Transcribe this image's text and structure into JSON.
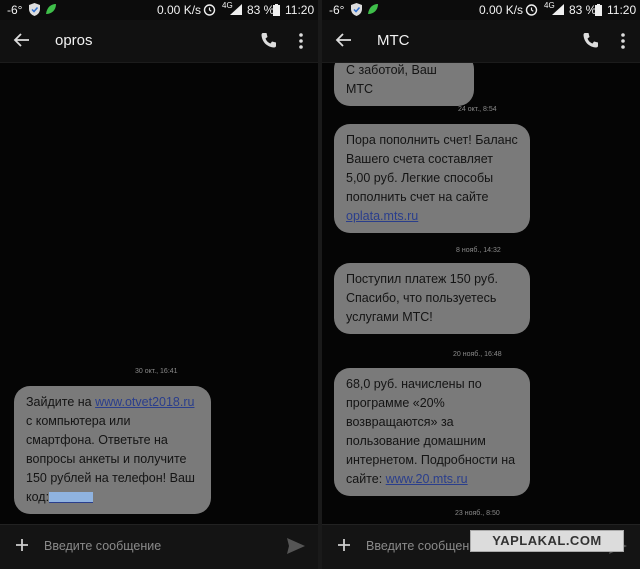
{
  "status_bar": {
    "temp": "-6°",
    "speed": "0.00 K/s",
    "network": "4G",
    "battery": "83 %",
    "time": "11:20"
  },
  "left": {
    "title": "opros",
    "stamp": "30 окт., 16:41",
    "message": {
      "before_link": "Зайдите на ",
      "link": "www.otvet2018.ru",
      "after_link": " с компьютера или смартфона. Ответьте на вопросы анкеты и получите 150 рублей на телефон! Ваш код:"
    },
    "compose_placeholder": "Введите сообщение"
  },
  "right": {
    "title": "МТС",
    "top_fragment": "С заботой, Ваш МТС",
    "stamp1": "24 окт., 8:54",
    "msg1_text": "Пора пополнить счет! Баланс Вашего счета составляет 5,00 руб. Легкие способы пополнить счет на сайте ",
    "msg1_link": "oplata.mts.ru",
    "stamp2": "8 нояб., 14:32",
    "msg2": "Поступил платеж 150 руб. Спасибо, что пользуетесь услугами МТС!",
    "stamp3": "20 нояб., 16:48",
    "msg3_text": "68,0 руб. начислены по программе «20% возвращаются» за пользование домашним интернетом. Подробности на сайте: ",
    "msg3_link": "www.20.mts.ru",
    "stamp4": "23 нояб., 8:50",
    "compose_placeholder": "Введите сообщение"
  },
  "watermark": "YAPLAKAL.COM"
}
